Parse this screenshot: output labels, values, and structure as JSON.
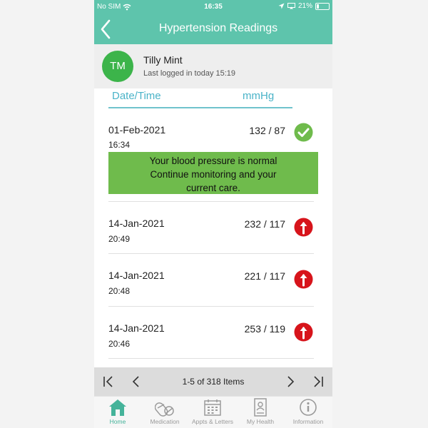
{
  "status_bar": {
    "carrier": "No SIM",
    "time": "16:35",
    "battery": "21%",
    "battery_level": 0.21
  },
  "nav": {
    "title": "Hypertension Readings"
  },
  "user": {
    "initials": "TM",
    "name": "Tilly Mint",
    "last_login": "Last logged in today 15:19",
    "avatar_color": "#3cb44a"
  },
  "table_headers": {
    "date_time": "Date/Time",
    "mmhg": "mmHg"
  },
  "readings": [
    {
      "date": "01-Feb-2021",
      "time": "16:34",
      "value": "132 / 87",
      "status": "normal",
      "icon": "check-icon"
    },
    {
      "date": "14-Jan-2021",
      "time": "20:49",
      "value": "232 / 117",
      "status": "high",
      "icon": "arrow-up-icon"
    },
    {
      "date": "14-Jan-2021",
      "time": "20:48",
      "value": "221 / 117",
      "status": "high",
      "icon": "arrow-up-icon"
    },
    {
      "date": "14-Jan-2021",
      "time": "20:46",
      "value": "253 / 119",
      "status": "high",
      "icon": "arrow-up-icon"
    }
  ],
  "advice": {
    "line1": "Your blood pressure is normal",
    "line2": "Continue monitoring and your",
    "line3": "current care."
  },
  "pagination": {
    "text": "1-5 of 318 Items"
  },
  "tabs": [
    {
      "label": "Home",
      "icon": "home-icon",
      "active": true
    },
    {
      "label": "Medication",
      "icon": "pills-icon",
      "active": false
    },
    {
      "label": "Appts & Letters",
      "icon": "calendar-icon",
      "active": false
    },
    {
      "label": "My Health",
      "icon": "health-record-icon",
      "active": false
    },
    {
      "label": "Information",
      "icon": "info-icon",
      "active": false
    }
  ],
  "colors": {
    "brand": "#5ec4ac",
    "normal": "#6fbb4c",
    "high": "#d7141b",
    "header_text": "#4ab3c8"
  }
}
